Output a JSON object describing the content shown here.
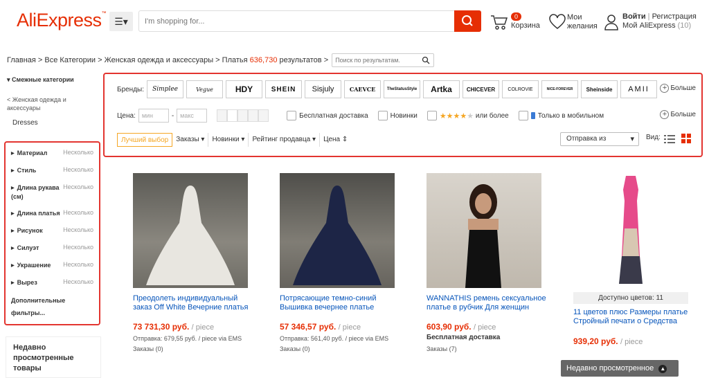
{
  "header": {
    "logo": "AliExpress",
    "logo_mark": "™",
    "search_placeholder": "I'm shopping for...",
    "cart_count": "0",
    "cart_label": "Корзина",
    "wishlist_label_1": "Мои",
    "wishlist_label_2": "желания",
    "login": "Войти",
    "sep": "|",
    "register": "Регистрация",
    "my_ali": "Мой AliExpress",
    "my_ali_count": "(10)"
  },
  "breadcrumb": {
    "home": "Главная",
    "all_cat": "Все Категории",
    "women": "Женская одежда и аксессуары",
    "dresses": "Платья",
    "count": "636,730",
    "results": "результатов",
    "search_placeholder": "Поиск по результатам."
  },
  "sidebar": {
    "related_title": "Смежные категории",
    "back_link": "< Женская одежда и аксессуары",
    "current": "Dresses",
    "filters": [
      {
        "name": "Материал",
        "value": "Несколько"
      },
      {
        "name": "Стиль",
        "value": "Несколько"
      },
      {
        "name": "Длина рукава (см)",
        "value": "Несколько"
      },
      {
        "name": "Длина платья",
        "value": "Несколько"
      },
      {
        "name": "Рисунок",
        "value": "Несколько"
      },
      {
        "name": "Силуэт",
        "value": "Несколько"
      },
      {
        "name": "Украшение",
        "value": "Несколько"
      },
      {
        "name": "Вырез",
        "value": "Несколько"
      }
    ],
    "more_filters_1": "Дополнительные",
    "more_filters_2": "фильтры...",
    "recent_1": "Недавно",
    "recent_2": "просмотренные товары"
  },
  "filters": {
    "brands_label": "Бренды:",
    "brands": [
      "Simplee",
      "Vegue",
      "HDY",
      "SHEIN",
      "Sisjuly",
      "CAEVCE",
      "TheStatusStyle",
      "Artka",
      "CHICEVER",
      "COLROVIE",
      "NICE-FOREVER",
      "Sheinside",
      "AMII"
    ],
    "more": "Больше",
    "price_label": "Цена:",
    "price_min": "мин",
    "price_dash": "-",
    "price_max": "макс",
    "free_shipping": "Бесплатная доставка",
    "new": "Новинки",
    "rating_more": "или более",
    "mobile_only": "Только в мобильном",
    "more2": "Больше",
    "sort": {
      "best": "Лучший выбор",
      "orders": "Заказы",
      "newest": "Новинки",
      "seller": "Рейтинг продавца",
      "price": "Цена"
    },
    "ship_from": "Отправка из",
    "view_label": "Вид:"
  },
  "products": [
    {
      "title_1": "Преодолеть индивидуальный",
      "title_2": "заказ Off White Вечерние платья",
      "price": "73 731,30 руб.",
      "unit": "/ piece",
      "shipping": "Отправка: 679,55 руб. / piece via EMS",
      "orders": "Заказы (0)"
    },
    {
      "title_1": "Потрясающие темно-синий",
      "title_2": "Вышивка вечернее платье",
      "price": "57 346,57 руб.",
      "unit": "/ piece",
      "shipping": "Отправка: 561,40 руб. / piece via EMS",
      "orders": "Заказы (0)"
    },
    {
      "title_1": "WANNATHIS ремень сексуальное",
      "title_2": "платье в рубчик Для женщин",
      "price": "603,90 руб.",
      "unit": "/ piece",
      "shipping": "Бесплатная доставка",
      "orders": "Заказы (7)"
    },
    {
      "title_1": "11 цветов плюс Размеры платье",
      "title_2": "Стройный печати о Средства",
      "price": "939,20 руб.",
      "unit": "/ piece",
      "avail": "Доступно цветов: 11"
    }
  ],
  "recent_bar": "Недавно просмотренное"
}
